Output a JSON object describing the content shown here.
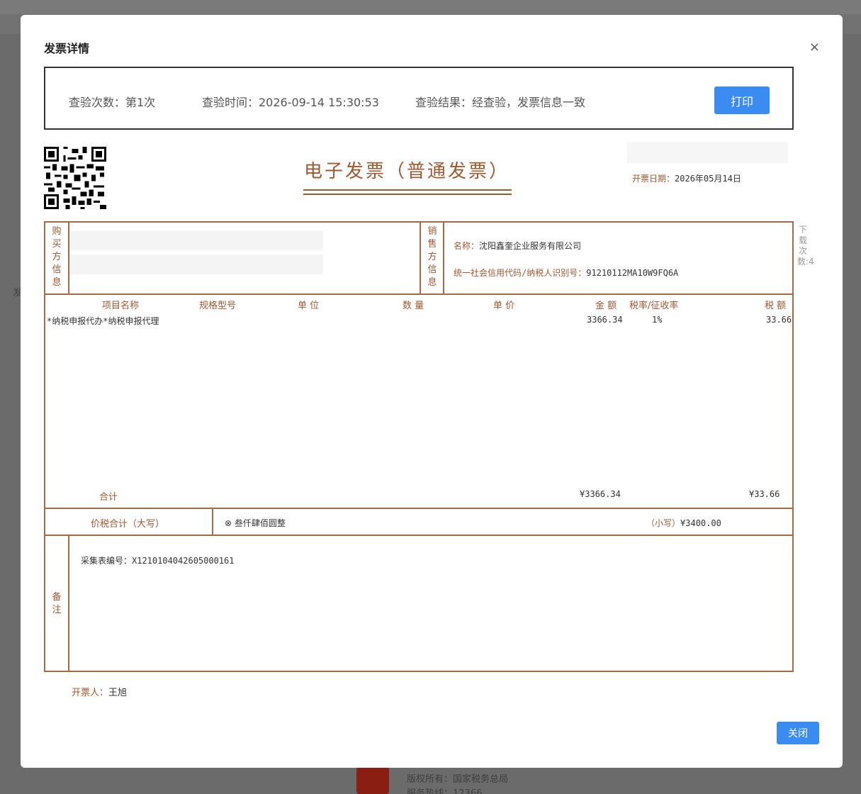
{
  "background": {
    "side_fragment": "发",
    "footer_line1": "版权所有：国家税务总局",
    "footer_line2": "服务热线：12366"
  },
  "modal": {
    "title": "发票详情",
    "close_icon": "×"
  },
  "verify": {
    "count": "查验次数：第1次",
    "time": "查验时间：2026-09-14 15:30:53",
    "result": "查验结果：经查验，发票信息一致",
    "print_label": "打印"
  },
  "invoice": {
    "title": "电子发票（普通发票）",
    "issue_date_label": "开票日期：",
    "issue_date": "2026年05月14日",
    "download_count": "下载次数:4",
    "buyer_label": [
      "购",
      "买",
      "方",
      "信",
      "息"
    ],
    "seller_label": [
      "销",
      "售",
      "方",
      "信",
      "息"
    ],
    "seller": {
      "name_label": "名称：",
      "name": "沈阳鑫奎企业服务有限公司",
      "tax_id_label": "统一社会信用代码/纳税人识别号：",
      "tax_id": "91210112MA10W9FQ6A"
    },
    "columns": {
      "item_name": "项目名称",
      "spec": "规格型号",
      "unit": "单 位",
      "qty": "数 量",
      "unit_price": "单 价",
      "amount": "金 额",
      "tax_rate": "税率/征收率",
      "tax": "税 额"
    },
    "items": [
      {
        "name": "*纳税申报代办*纳税申报代理",
        "amount": "3366.34",
        "tax_rate": "1%",
        "tax": "33.66"
      }
    ],
    "subtotal_label": "合计",
    "subtotal_amount": "¥3366.34",
    "subtotal_tax": "¥33.66",
    "total_label": "价税合计（大写）",
    "total_capital": "⊗ 叁仟肆佰圆整",
    "total_small_label": "（小写）",
    "total_small": "¥3400.00",
    "remark_label": [
      "备",
      "注"
    ],
    "remark": "采集表编号：X1210104042605000161",
    "drawer_label": "开票人：",
    "drawer": "王旭"
  },
  "footer": {
    "close_label": "关闭"
  }
}
